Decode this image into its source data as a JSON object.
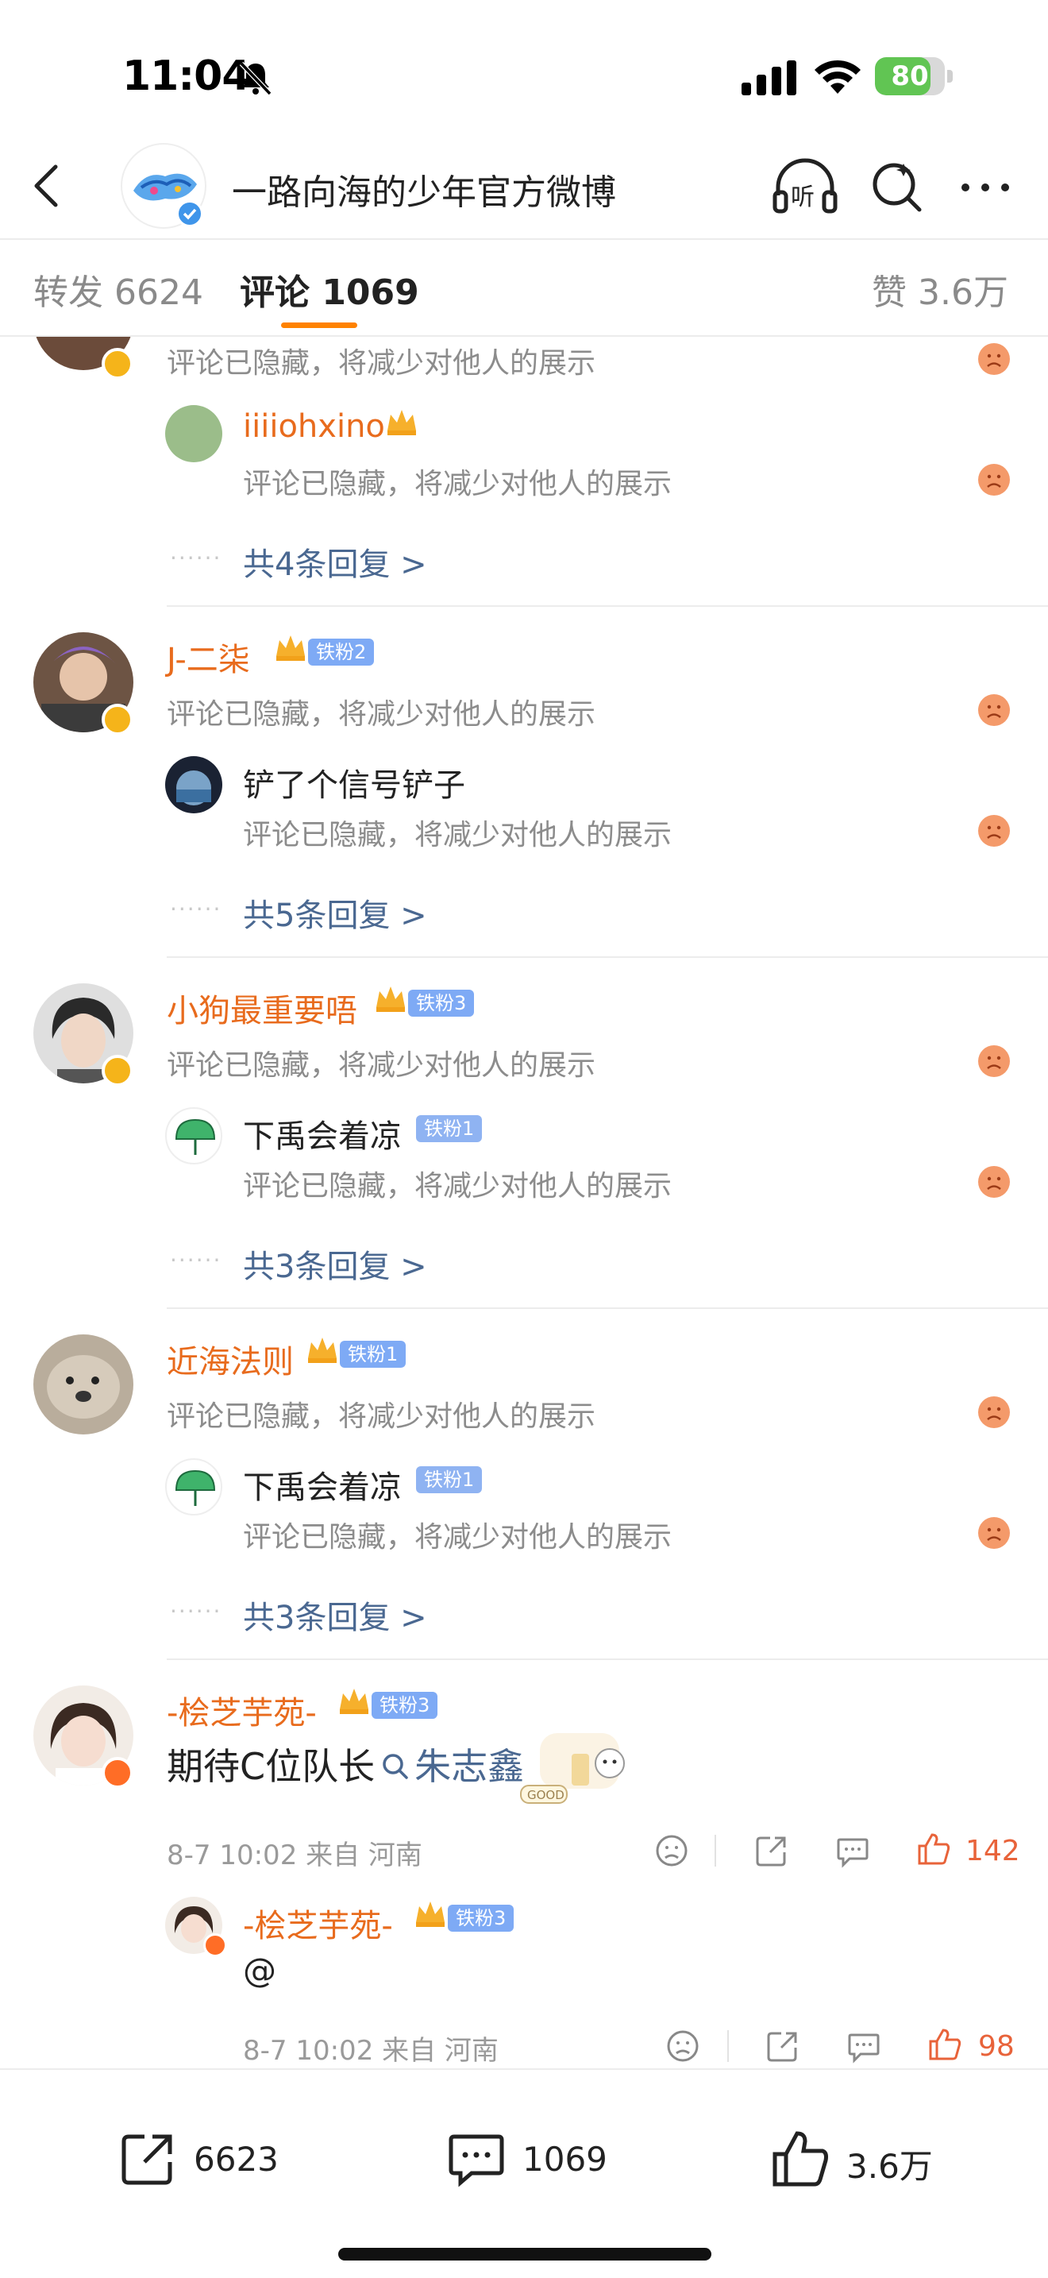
{
  "status": {
    "time": "11:04",
    "battery": "80",
    "battery_level": 0.8
  },
  "nav": {
    "title": "一路向海的少年官方微博",
    "listen_label": "听"
  },
  "tabs": {
    "repost": "转发 6624",
    "comments": "评论 1069",
    "likes": "赞 3.6万"
  },
  "comments": [
    {
      "hidden": "评论已隐藏，将减少对他人的展示",
      "reply": {
        "name": "iiiiohxino",
        "hidden": "评论已隐藏，将减少对他人的展示"
      },
      "more": "共4条回复 >"
    },
    {
      "name": "J-二柒",
      "fan": "铁粉2",
      "hidden": "评论已隐藏，将减少对他人的展示",
      "reply": {
        "name": "铲了个信号铲子",
        "hidden": "评论已隐藏，将减少对他人的展示"
      },
      "more": "共5条回复 >"
    },
    {
      "name": "小狗最重要唔",
      "fan": "铁粉3",
      "hidden": "评论已隐藏，将减少对他人的展示",
      "reply": {
        "name": "下禹会着凉",
        "fan": "铁粉1",
        "hidden": "评论已隐藏，将减少对他人的展示"
      },
      "more": "共3条回复 >"
    },
    {
      "name": "近海法则",
      "fan": "铁粉1",
      "hidden": "评论已隐藏，将减少对他人的展示",
      "reply": {
        "name": "下禹会着凉",
        "fan": "铁粉1",
        "hidden": "评论已隐藏，将减少对他人的展示"
      },
      "more": "共3条回复 >"
    },
    {
      "name": "-桧芝芋苑-",
      "fan": "铁粉3",
      "text": "期待C位队长",
      "topic": "朱志鑫",
      "sticker_text": "GOOD",
      "meta": "8-7 10:02 来自 河南",
      "likes": "142",
      "reply": {
        "name": "-桧芝芋苑-",
        "fan": "铁粉3",
        "text": "@",
        "meta": "8-7 10:02 来自 河南",
        "likes": "98"
      }
    }
  ],
  "toolbar": {
    "repost": "6623",
    "comments": "1069",
    "likes": "3.6万"
  },
  "colors": {
    "accent": "#ff8200",
    "name": "#e86b1d",
    "link": "#4a6891",
    "fan_tag": "#7eaaf5"
  }
}
